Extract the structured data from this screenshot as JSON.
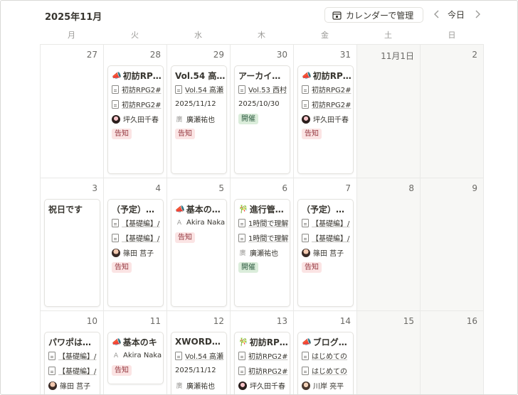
{
  "header": {
    "month": "2025年11月",
    "manage_label": "カレンダーで管理",
    "today_label": "今日"
  },
  "weekdays": [
    "月",
    "火",
    "水",
    "木",
    "金",
    "土",
    "日"
  ],
  "weeks": [
    {
      "dates": [
        "27",
        "28",
        "29",
        "30",
        "31",
        "11月1日",
        "2"
      ],
      "cards": [
        null,
        {
          "emoji": "📣",
          "title": "初訪RP…",
          "props": [
            {
              "kind": "doc",
              "text": "初訪RPG2#"
            },
            {
              "kind": "doc",
              "text": "初訪RPG2#"
            },
            {
              "kind": "avatar",
              "text": "坪久田千春"
            }
          ],
          "tag": {
            "text": "告知",
            "color": "red"
          }
        },
        {
          "emoji": "",
          "title": "Vol.54 高…",
          "props": [
            {
              "kind": "doc",
              "text": "Vol.54 高瀬"
            },
            {
              "kind": "text",
              "text": "2025/11/12"
            },
            {
              "kind": "init",
              "initial": "廣",
              "text": "廣瀬祐也"
            }
          ],
          "tag": {
            "text": "告知",
            "color": "red"
          }
        },
        {
          "emoji": "",
          "title": "アーカイ…",
          "props": [
            {
              "kind": "doc",
              "text": "Vol.53 西村"
            },
            {
              "kind": "text",
              "text": "2025/10/30"
            }
          ],
          "tag": {
            "text": "開催",
            "color": "green"
          }
        },
        {
          "emoji": "📣",
          "title": "初訪RP…",
          "props": [
            {
              "kind": "doc",
              "text": "初訪RPG2#"
            },
            {
              "kind": "doc",
              "text": "初訪RPG2#"
            },
            {
              "kind": "avatar",
              "text": "坪久田千春"
            }
          ],
          "tag": {
            "text": "告知",
            "color": "red"
          }
        },
        null,
        null
      ]
    },
    {
      "dates": [
        "3",
        "4",
        "5",
        "6",
        "7",
        "8",
        "9"
      ],
      "cards": [
        {
          "emoji": "",
          "title": "祝日です",
          "props": [],
          "tag": null
        },
        {
          "emoji": "",
          "title": "（予定）…",
          "props": [
            {
              "kind": "doc",
              "text": "【基礎編】/"
            },
            {
              "kind": "doc",
              "text": "【基礎編】/"
            },
            {
              "kind": "avatar",
              "text": "篠田 莒子"
            }
          ],
          "tag": {
            "text": "告知",
            "color": "red"
          }
        },
        {
          "emoji": "📣",
          "title": "基本の…",
          "props": [
            {
              "kind": "init",
              "initial": "A",
              "text": "Akira Naka"
            }
          ],
          "tag": {
            "text": "告知",
            "color": "red"
          }
        },
        {
          "emoji": "🎋",
          "title": "進行管…",
          "props": [
            {
              "kind": "doc",
              "text": "1時間で理解"
            },
            {
              "kind": "doc",
              "text": "1時間で理解"
            },
            {
              "kind": "init",
              "initial": "廣",
              "text": "廣瀬祐也"
            }
          ],
          "tag": {
            "text": "開催",
            "color": "green"
          }
        },
        {
          "emoji": "",
          "title": "（予定）…",
          "props": [
            {
              "kind": "doc",
              "text": "【基礎編】/"
            },
            {
              "kind": "doc",
              "text": "【基礎編】/"
            },
            {
              "kind": "avatar",
              "text": "篠田 莒子"
            }
          ],
          "tag": {
            "text": "告知",
            "color": "red"
          }
        },
        null,
        null
      ]
    },
    {
      "dates": [
        "10",
        "11",
        "12",
        "13",
        "14",
        "15",
        "16"
      ],
      "cards": [
        {
          "emoji": "",
          "title": "パワポは…",
          "props": [
            {
              "kind": "doc",
              "text": "【基礎編】/"
            },
            {
              "kind": "doc",
              "text": "【基礎編】/"
            },
            {
              "kind": "avatar",
              "text": "篠田 莒子"
            }
          ],
          "tag": null
        },
        {
          "emoji": "📣",
          "title": "基本のキ",
          "props": [
            {
              "kind": "init",
              "initial": "A",
              "text": "Akira Naka"
            }
          ],
          "tag": {
            "text": "告知",
            "color": "red"
          }
        },
        {
          "emoji": "",
          "title": "XWORD…",
          "props": [
            {
              "kind": "doc",
              "text": "Vol.54 高瀬"
            },
            {
              "kind": "text",
              "text": "2025/11/12"
            },
            {
              "kind": "init",
              "initial": "廣",
              "text": "廣瀬祐也"
            }
          ],
          "tag": null
        },
        {
          "emoji": "🎋",
          "title": "初訪RP…",
          "props": [
            {
              "kind": "doc",
              "text": "初訪RPG2#"
            },
            {
              "kind": "doc",
              "text": "初訪RPG2#"
            },
            {
              "kind": "avatar",
              "text": "坪久田千春"
            }
          ],
          "tag": null
        },
        {
          "emoji": "📣",
          "title": "ブログ…",
          "props": [
            {
              "kind": "doc",
              "text": "はじめての"
            },
            {
              "kind": "doc",
              "text": "はじめての"
            },
            {
              "kind": "avatar",
              "text": "川岸 亮平"
            }
          ],
          "tag": null
        },
        null,
        null
      ]
    }
  ]
}
